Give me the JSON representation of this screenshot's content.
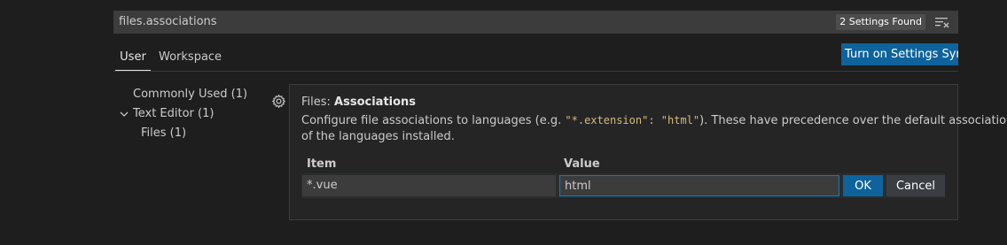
{
  "search": {
    "value": "files.associations",
    "found_badge": "2 Settings Found",
    "clear_icon": "clear-filter-icon"
  },
  "tabs": {
    "user": "User",
    "workspace": "Workspace"
  },
  "sync_button": "Turn on Settings Sync",
  "toc": {
    "commonly_used": "Commonly Used (1)",
    "text_editor": "Text Editor (1)",
    "files": "Files (1)",
    "chevron_icon": "chevron-down-icon"
  },
  "setting": {
    "gear_icon": "gear-icon",
    "category": "Files: ",
    "name": "Associations",
    "desc_pre": "Configure file associations to languages (e.g. ",
    "desc_code": "\"*.extension\": \"html\"",
    "desc_post": "). These have precedence over the default associations",
    "desc_line2": "of the languages installed.",
    "table": {
      "col_item": "Item",
      "col_value": "Value",
      "item": "*.vue",
      "value": "html",
      "ok": "OK",
      "cancel": "Cancel"
    }
  },
  "colors": {
    "accent": "#0e639c",
    "focus_border": "#007fd4",
    "background": "#1e1e1e"
  }
}
